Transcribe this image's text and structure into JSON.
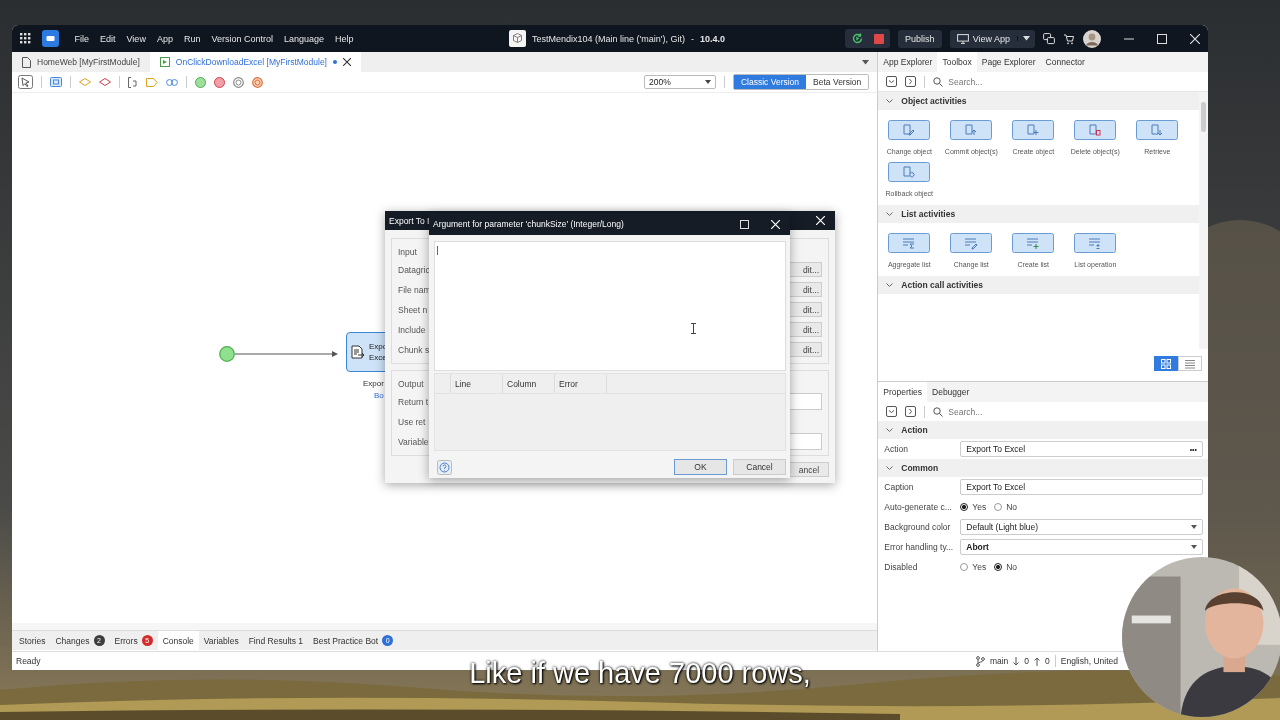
{
  "title_bar": {
    "menus": [
      "File",
      "Edit",
      "View",
      "App",
      "Run",
      "Version Control",
      "Language",
      "Help"
    ],
    "app_title": "TestMendix104 (Main line ('main'), Git)",
    "separator": "-",
    "version": "10.4.0",
    "publish": "Publish",
    "view_app": "View App"
  },
  "editor_tabs": [
    {
      "label": "HomeWeb [MyFirstModule]",
      "selected": false,
      "unsaved": false
    },
    {
      "label": "OnClickDownloadExcel [MyFirstModule]",
      "selected": true,
      "unsaved": true
    }
  ],
  "editor_toolbar": {
    "zoom": "200%",
    "versions": [
      {
        "label": "Classic Version",
        "selected": true
      },
      {
        "label": "Beta Version",
        "selected": false
      }
    ]
  },
  "canvas": {
    "activity": {
      "lines": [
        "Expo",
        "Exce"
      ],
      "caption": "Expor",
      "subcaption": "Bo"
    }
  },
  "export_dialog": {
    "title": "Export To I",
    "input_legend": "Input",
    "inputs": [
      {
        "label": "Datagric",
        "button": "dit..."
      },
      {
        "label": "File nam",
        "button": "dit..."
      },
      {
        "label": "Sheet n",
        "button": "dit..."
      },
      {
        "label": "Include",
        "button": "dit..."
      },
      {
        "label": "Chunk s",
        "button": "dit..."
      }
    ],
    "output_legend": "Output",
    "outputs": [
      {
        "label": "Return t",
        "field": true
      },
      {
        "label": "Use ret",
        "field": false
      },
      {
        "label": "Variable",
        "field": true
      }
    ],
    "cancel": "ancel"
  },
  "argument_dialog": {
    "title": "Argument for parameter 'chunkSize' (Integer/Long)",
    "columns": [
      "Line",
      "Column",
      "Error"
    ],
    "buttons": [
      {
        "label": "OK",
        "default": true
      },
      {
        "label": "Cancel",
        "default": false
      }
    ]
  },
  "bottom_tabs": [
    {
      "label": "Stories",
      "selected": false
    },
    {
      "label": "Changes",
      "selected": false,
      "count": "2",
      "color": "#3d3d3d"
    },
    {
      "label": "Errors",
      "selected": false,
      "count": "5",
      "color": "#d42a2a"
    },
    {
      "label": "Console",
      "selected": true
    },
    {
      "label": "Variables",
      "selected": false
    },
    {
      "label": "Find Results 1",
      "selected": false
    },
    {
      "label": "Best Practice Bot",
      "selected": false,
      "count": "0",
      "color": "#2f6fd8"
    }
  ],
  "status_bar": {
    "text": "Ready",
    "branch": "main",
    "incoming": "0",
    "outgoing": "0",
    "language": "English, United"
  },
  "toolbox": {
    "tabs": [
      {
        "label": "App Explorer",
        "selected": false
      },
      {
        "label": "Toolbox",
        "selected": true
      },
      {
        "label": "Page Explorer",
        "selected": false
      },
      {
        "label": "Connector",
        "selected": false
      }
    ],
    "search_placeholder": "Search...",
    "sections": [
      {
        "title": "Object activities",
        "expanded": true,
        "items": [
          {
            "label": "Change object",
            "kind": "change"
          },
          {
            "label": "Commit object(s)",
            "kind": "commit"
          },
          {
            "label": "Create object",
            "kind": "create"
          },
          {
            "label": "Delete object(s)",
            "kind": "delete"
          },
          {
            "label": "Retrieve",
            "kind": "retrieve"
          },
          {
            "label": "Rollback object",
            "kind": "rollback"
          }
        ]
      },
      {
        "title": "List activities",
        "expanded": true,
        "items": [
          {
            "label": "Aggregate list",
            "kind": "aggregate"
          },
          {
            "label": "Change list",
            "kind": "change-list"
          },
          {
            "label": "Create list",
            "kind": "create-list"
          },
          {
            "label": "List operation",
            "kind": "operation"
          }
        ]
      },
      {
        "title": "Action call activities",
        "expanded": true
      }
    ],
    "view_modes": [
      {
        "kind": "grid",
        "selected": true
      },
      {
        "kind": "list",
        "selected": false
      }
    ]
  },
  "properties": {
    "tabs": [
      {
        "label": "Properties",
        "selected": true
      },
      {
        "label": "Debugger",
        "selected": false
      }
    ],
    "search_placeholder": "Search...",
    "sections": [
      {
        "title": "Action",
        "expanded": true,
        "rows": [
          {
            "label": "Action",
            "kind": "picker",
            "value": "Export To Excel",
            "more": "•••"
          }
        ]
      },
      {
        "title": "Common",
        "expanded": true,
        "rows": [
          {
            "label": "Caption",
            "kind": "text",
            "value": "Export To Excel"
          },
          {
            "label": "Auto-generate c...",
            "kind": "radio",
            "options": [
              {
                "label": "Yes",
                "selected": true
              },
              {
                "label": "No",
                "selected": false
              }
            ]
          },
          {
            "label": "Background color",
            "kind": "dropdown",
            "value": "Default (Light blue)",
            "bold": false
          },
          {
            "label": "Error handling ty...",
            "kind": "dropdown",
            "value": "Abort",
            "bold": true
          },
          {
            "label": "Disabled",
            "kind": "radio",
            "options": [
              {
                "label": "Yes",
                "selected": false
              },
              {
                "label": "No",
                "selected": true
              }
            ]
          }
        ]
      }
    ]
  },
  "subtitle": "Like if we have 7000 rows,"
}
